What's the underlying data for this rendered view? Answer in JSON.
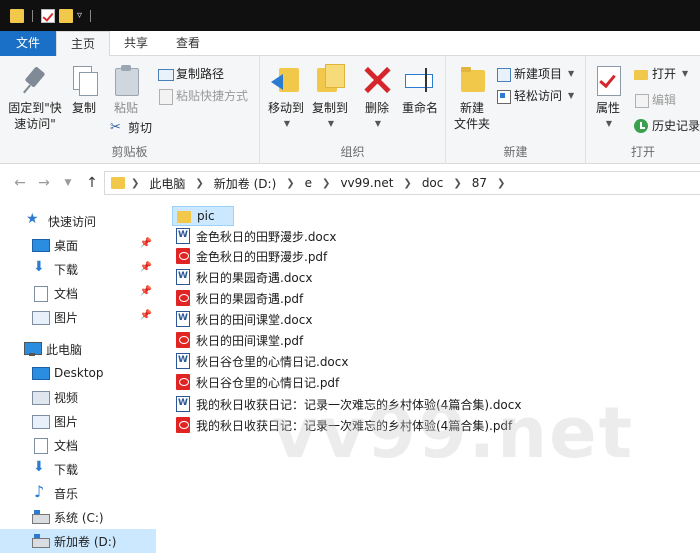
{
  "tabs": {
    "file": "文件",
    "home": "主页",
    "share": "共享",
    "view": "查看"
  },
  "ribbon": {
    "clipboard": {
      "label": "剪贴板",
      "pin_line1": "固定到\"快",
      "pin_line2": "速访问\"",
      "copy": "复制",
      "paste": "粘贴",
      "copy_path": "复制路径",
      "paste_shortcut": "粘贴快捷方式",
      "cut": "剪切"
    },
    "organize": {
      "label": "组织",
      "move_to": "移动到",
      "copy_to": "复制到",
      "delete": "删除",
      "rename": "重命名"
    },
    "new": {
      "label": "新建",
      "new_folder_line1": "新建",
      "new_folder_line2": "文件夹",
      "new_item": "新建项目",
      "easy_access": "轻松访问"
    },
    "open": {
      "label": "打开",
      "properties": "属性",
      "open": "打开",
      "edit": "编辑",
      "history": "历史记录"
    }
  },
  "address": {
    "crumbs": [
      "此电脑",
      "新加卷 (D:)",
      "e",
      "vv99.net",
      "doc",
      "87"
    ]
  },
  "navpane": {
    "quick_access": "快速访问",
    "quick_items": [
      "桌面",
      "下载",
      "文档",
      "图片"
    ],
    "this_pc": "此电脑",
    "pc_items": [
      "Desktop",
      "视频",
      "图片",
      "文档",
      "下载",
      "音乐",
      "系统 (C:)",
      "新加卷 (D:)"
    ]
  },
  "files": [
    {
      "name": "pic",
      "type": "folder"
    },
    {
      "name": "金色秋日的田野漫步.docx",
      "type": "docx"
    },
    {
      "name": "金色秋日的田野漫步.pdf",
      "type": "pdf"
    },
    {
      "name": "秋日的果园奇遇.docx",
      "type": "docx"
    },
    {
      "name": "秋日的果园奇遇.pdf",
      "type": "pdf"
    },
    {
      "name": "秋日的田间课堂.docx",
      "type": "docx"
    },
    {
      "name": "秋日的田间课堂.pdf",
      "type": "pdf"
    },
    {
      "name": "秋日谷仓里的心情日记.docx",
      "type": "docx"
    },
    {
      "name": "秋日谷仓里的心情日记.pdf",
      "type": "pdf"
    },
    {
      "name": "我的秋日收获日记：记录一次难忘的乡村体验(4篇合集).docx",
      "type": "docx"
    },
    {
      "name": "我的秋日收获日记：记录一次难忘的乡村体验(4篇合集).pdf",
      "type": "pdf"
    }
  ],
  "watermark": "vv99.net",
  "colors": {
    "accent": "#1a6fc6",
    "selection": "#cce8ff",
    "folder": "#f2c84b",
    "pdf": "#e02424"
  }
}
